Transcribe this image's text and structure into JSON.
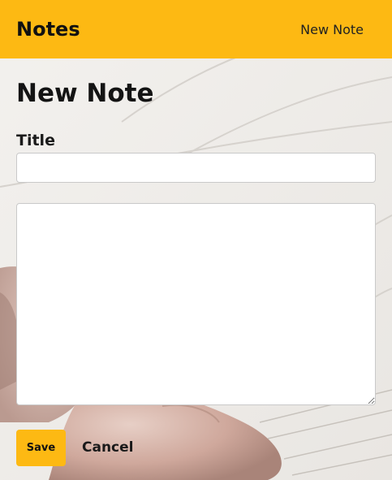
{
  "navbar": {
    "brand": "Notes",
    "new_note_link": "New Note"
  },
  "form": {
    "heading": "New Note",
    "title_label": "Title",
    "title_value": "",
    "body_value": "",
    "save_label": "Save",
    "cancel_label": "Cancel"
  },
  "colors": {
    "accent": "#fdb913",
    "text": "#141414"
  }
}
